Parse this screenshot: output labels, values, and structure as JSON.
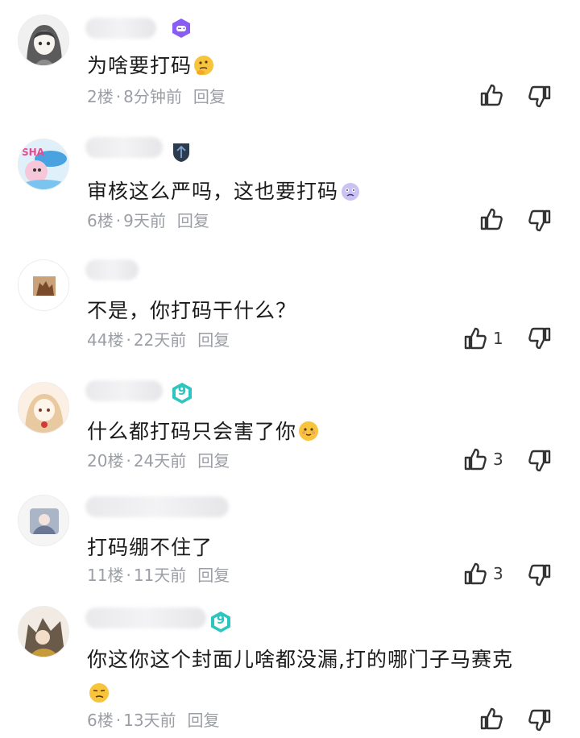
{
  "comments": [
    {
      "text": "为啥要打码",
      "floor": "2楼",
      "time": "8分钟前",
      "reply": "回复",
      "likes": ""
    },
    {
      "text": "审核这么严吗，这也要打码",
      "floor": "6楼",
      "time": "9天前",
      "reply": "回复",
      "likes": ""
    },
    {
      "text": "不是，你打码干什么？",
      "floor": "44楼",
      "time": "22天前",
      "reply": "回复",
      "likes": "1"
    },
    {
      "text": "什么都打码只会害了你",
      "floor": "20楼",
      "time": "24天前",
      "reply": "回复",
      "likes": "3"
    },
    {
      "text": "打码绷不住了",
      "floor": "11楼",
      "time": "11天前",
      "reply": "回复",
      "likes": "3"
    },
    {
      "text": "你这你这个封面儿啥都没漏,打的哪门子马赛克",
      "floor": "6楼",
      "time": "13天前",
      "reply": "回复",
      "likes": ""
    }
  ],
  "badges": {
    "level_9": "9"
  },
  "colors": {
    "meta": "#9b9ea4",
    "text": "#1b1b1b",
    "badge_purple": "#8a5cf6",
    "badge_teal": "#2ec5c0"
  }
}
